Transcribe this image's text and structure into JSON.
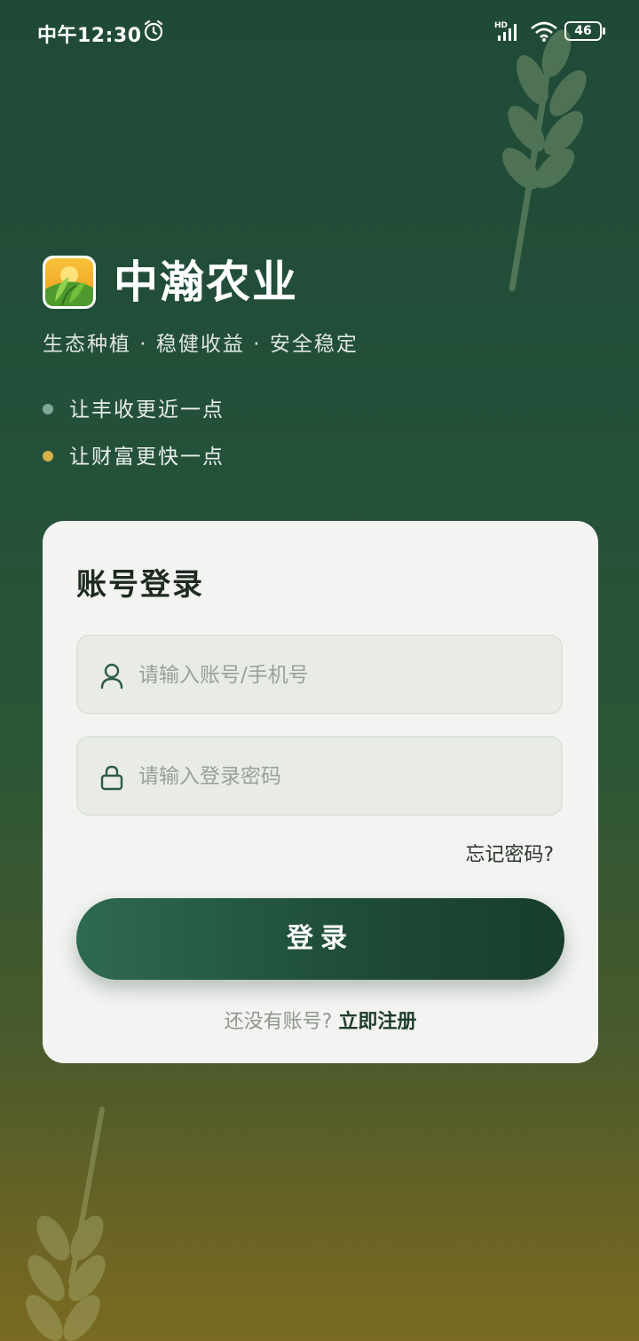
{
  "status_bar": {
    "time": "中午12:30",
    "network": "HD",
    "battery": "46"
  },
  "brand": {
    "name": "中瀚农业",
    "tagline": "生态种植 · 稳健收益 · 安全稳定"
  },
  "features": [
    {
      "text": "让丰收更近一点",
      "dot_color": "#7fa898"
    },
    {
      "text": "让财富更快一点",
      "dot_color": "#d6b24a"
    }
  ],
  "login": {
    "title": "账号登录",
    "account_placeholder": "请输入账号/手机号",
    "password_placeholder": "请输入登录密码",
    "forgot": "忘记密码?",
    "button": "登录",
    "no_account": "还没有账号?",
    "register": "立即注册"
  },
  "icons": [
    "alarm-icon",
    "signal-icon",
    "wifi-icon",
    "battery-icon",
    "app-logo",
    "user-icon",
    "lock-icon",
    "wheat-decoration"
  ],
  "colors": {
    "primary": "#1f4d38",
    "background_top": "#1f4a37",
    "background_bottom": "#7a6a22",
    "card": "#f3f4f2"
  }
}
